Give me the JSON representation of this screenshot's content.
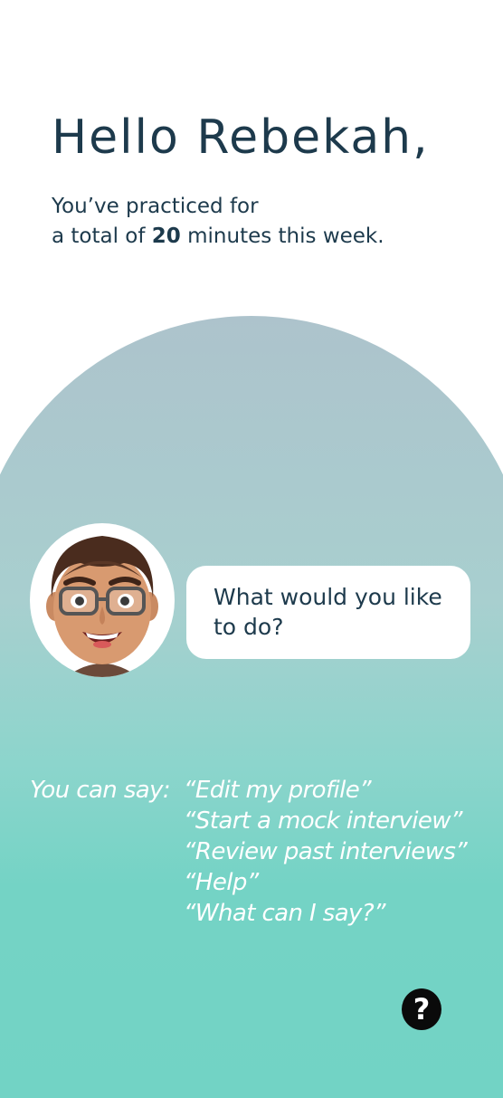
{
  "header": {
    "greeting": "Hello Rebekah,",
    "summary_line1": "You’ve practiced for",
    "summary_prefix": "a total of ",
    "minutes": "20",
    "summary_suffix": " minutes this week."
  },
  "assistant": {
    "avatar_icon": "memoji-avatar-icon",
    "prompt": "What would you like to do?"
  },
  "hints": {
    "lead": "You can say:",
    "phrases": [
      "“Edit my profile”",
      "“Start a mock interview”",
      "“Review past interviews”",
      "“Help”",
      "“What can I say?”"
    ]
  },
  "help": {
    "icon": "help-icon",
    "glyph": "?"
  },
  "colors": {
    "text_dark": "#1d3a4c",
    "arch_top": "#adc3cc",
    "arch_bottom": "#72d3c5",
    "hint_text": "#ffffff",
    "help_button": "#0a0a0a"
  }
}
